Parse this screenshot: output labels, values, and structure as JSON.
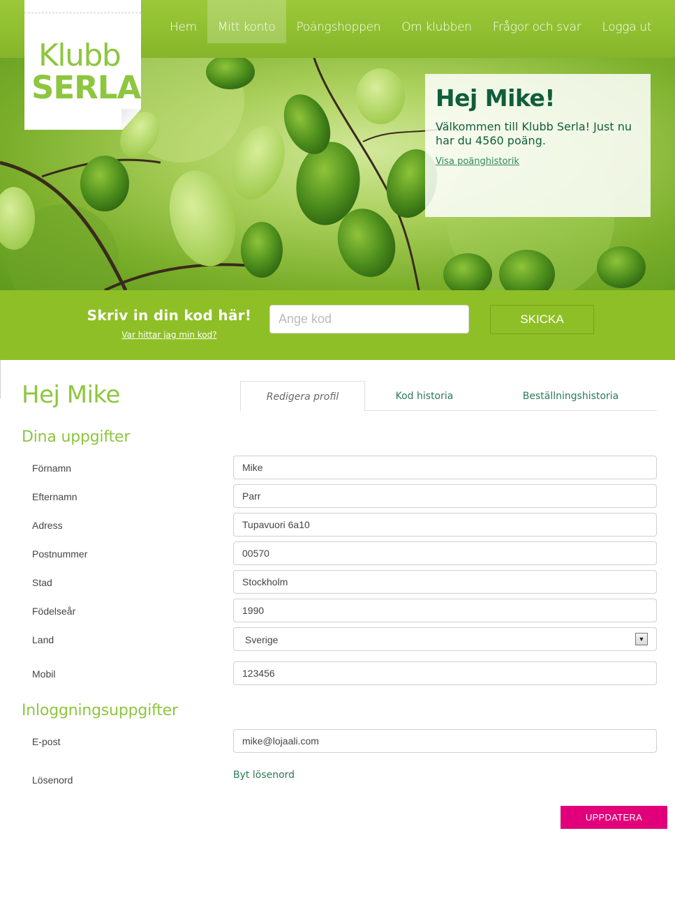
{
  "brand": {
    "line1": "Klubb",
    "line2": "SERLA"
  },
  "nav": [
    {
      "label": "Hem"
    },
    {
      "label": "Mitt konto"
    },
    {
      "label": "Poängshoppen"
    },
    {
      "label": "Om klubben"
    },
    {
      "label": "Frågor och svar"
    },
    {
      "label": "Logga ut"
    }
  ],
  "hero": {
    "title": "Hej Mike!",
    "text": "Välkommen till Klubb Serla! Just nu har du 4560 poäng.",
    "link": "Visa poänghistorik"
  },
  "code": {
    "title": "Skriv in din kod här!",
    "help_link": "Var hittar jag min kod?",
    "placeholder": "Ange kod",
    "submit": "SKICKA"
  },
  "profile": {
    "title": "Hej Mike",
    "tabs": [
      "Redigera profil",
      "Kod historia",
      "Beställningshistoria"
    ],
    "section1": "Dina uppgifter",
    "fields": [
      {
        "label": "Förnamn",
        "value": "Mike"
      },
      {
        "label": "Efternamn",
        "value": "Parr"
      },
      {
        "label": "Adress",
        "value": "Tupavuori 6a10"
      },
      {
        "label": "Postnummer",
        "value": "00570"
      },
      {
        "label": "Stad",
        "value": "Stockholm"
      },
      {
        "label": "Födelseår",
        "value": "1990"
      },
      {
        "label": "Land",
        "value": "Sverige"
      },
      {
        "label": "Mobil",
        "value": "123456"
      }
    ],
    "section2": "Inloggningsuppgifter",
    "email_label": "E-post",
    "email_value": "mike@lojaali.com",
    "password_label": "Lösenord",
    "password_link": "Byt lösenord",
    "update": "UPPDATERA"
  },
  "colors": {
    "brand_green": "#8dc63f",
    "dark_green": "#0f5e3c",
    "update_pink": "#e2007a"
  }
}
